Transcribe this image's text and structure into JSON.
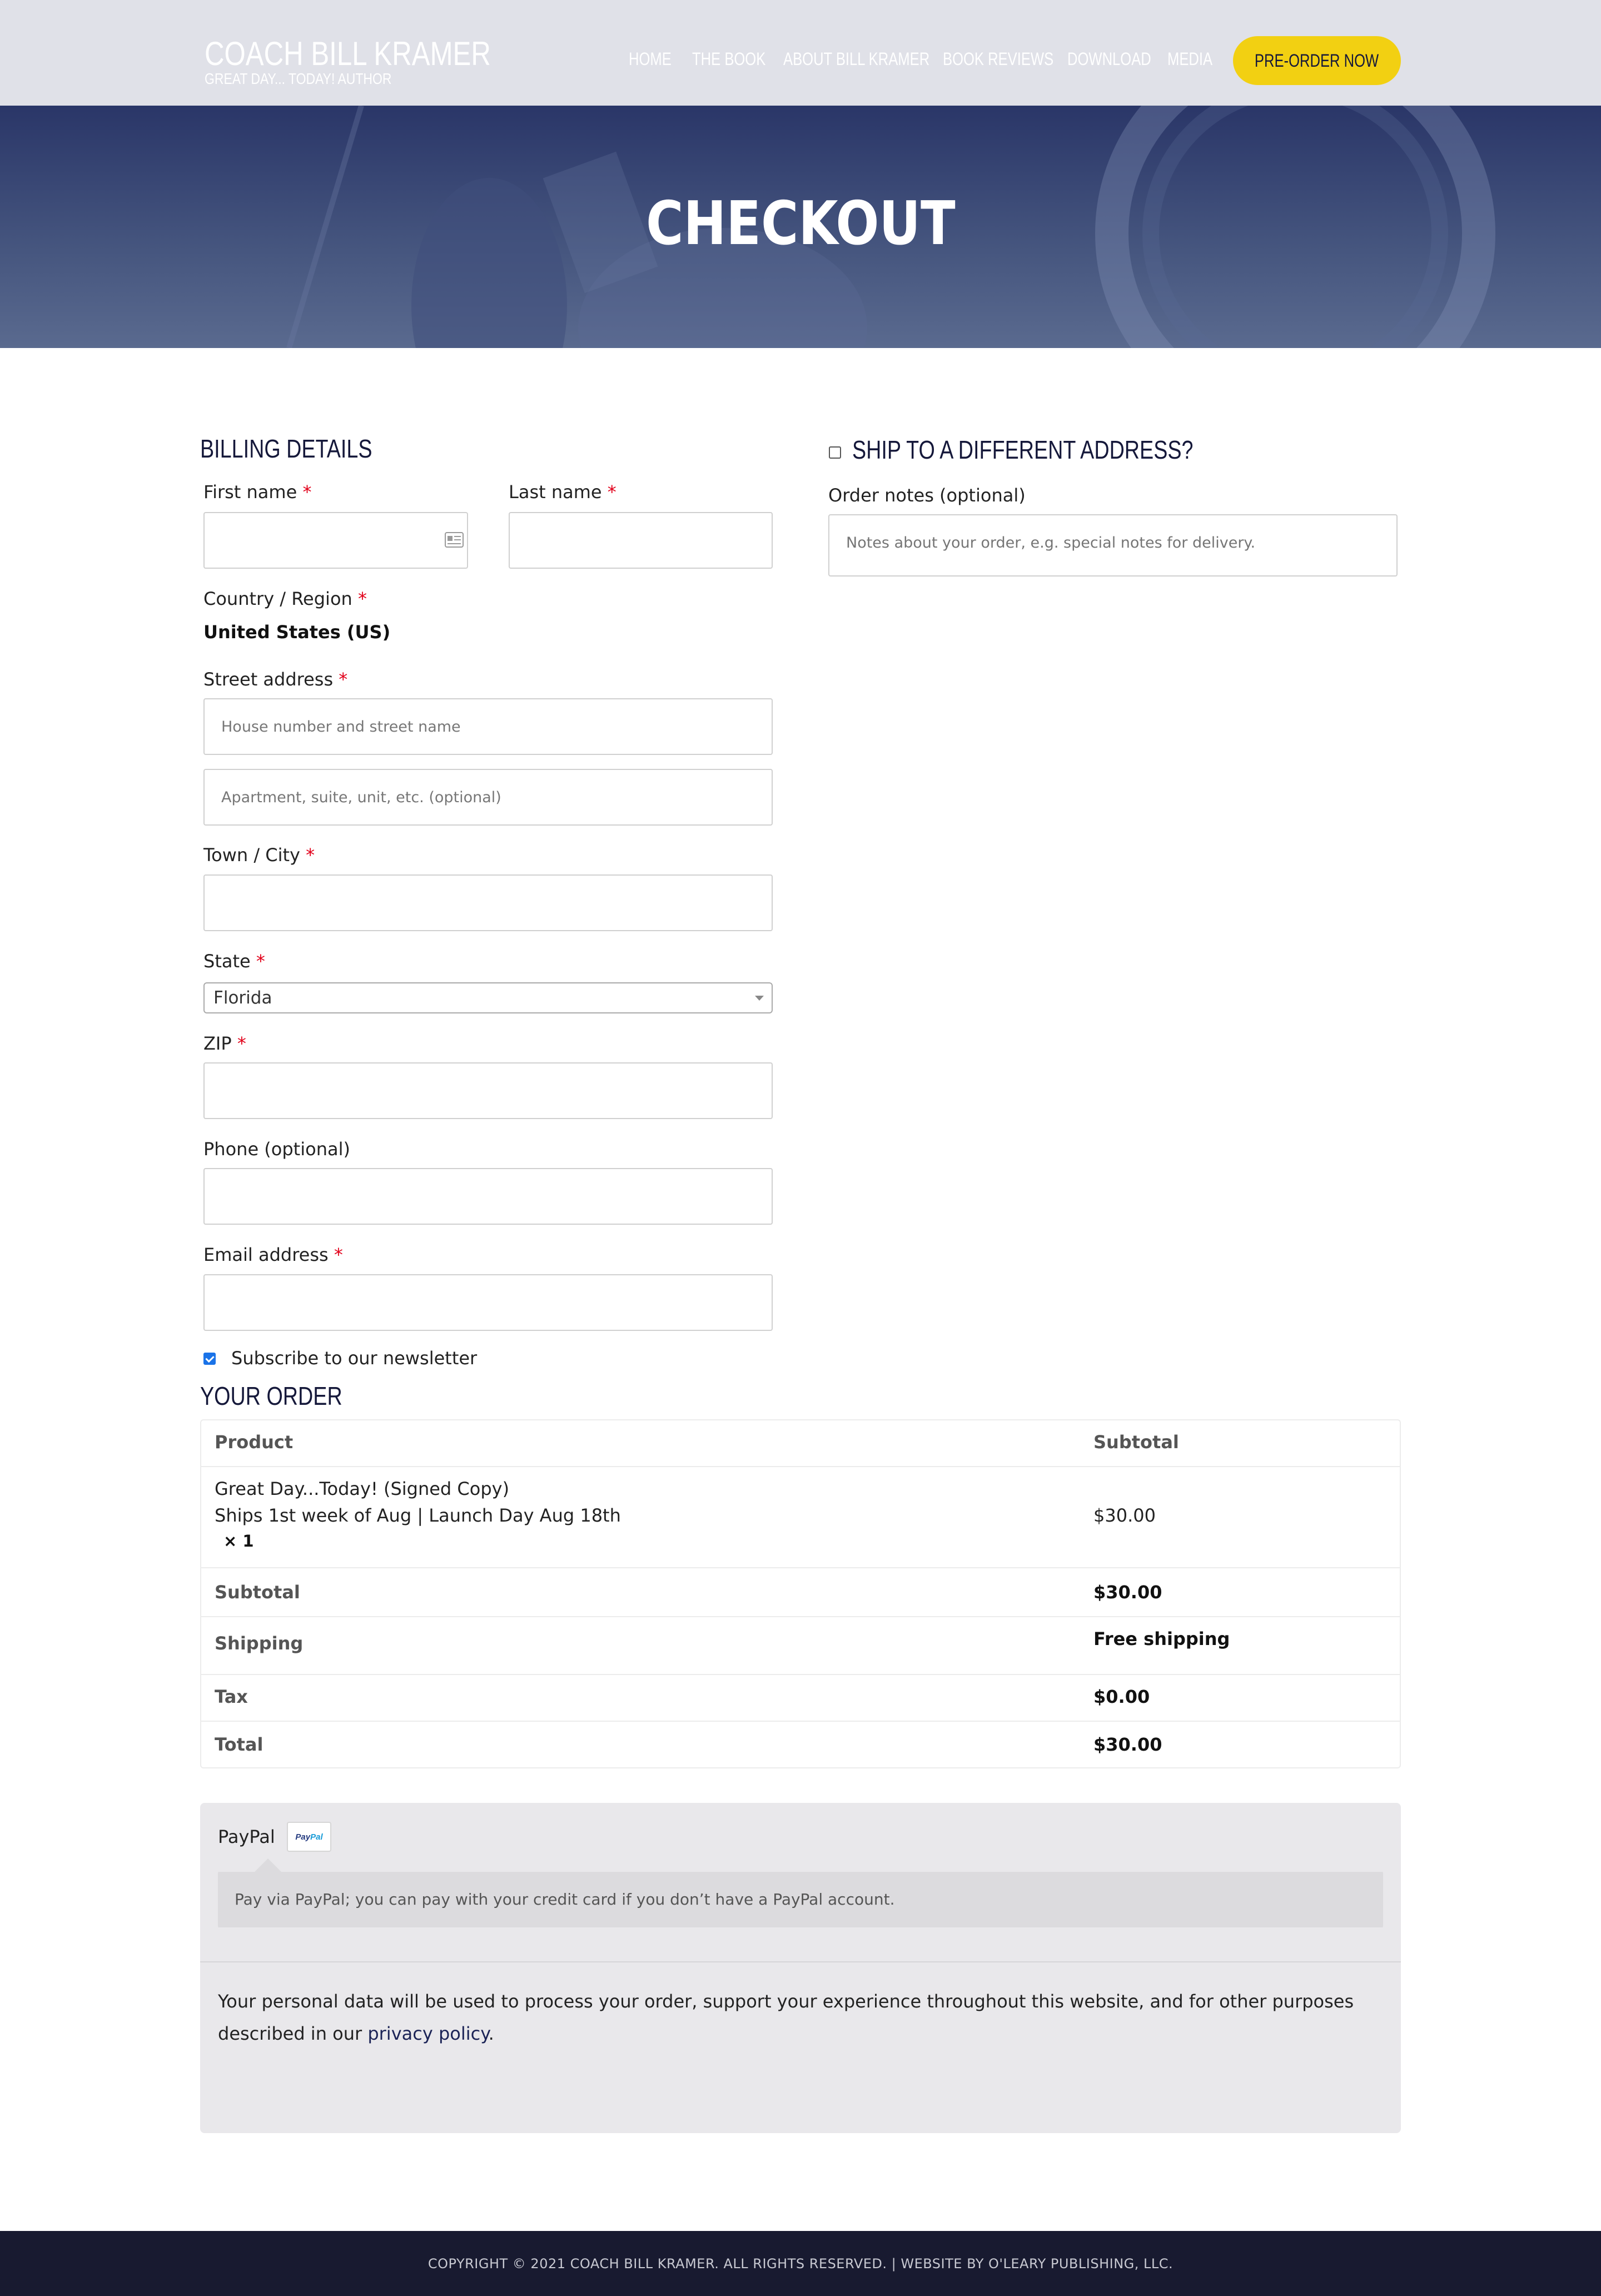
{
  "header": {
    "brand_title": "COACH BILL KRAMER",
    "brand_subtitle": "GREAT DAY... TODAY! AUTHOR",
    "nav": [
      "HOME",
      "THE BOOK",
      "ABOUT BILL KRAMER",
      "BOOK REVIEWS",
      "DOWNLOAD",
      "MEDIA"
    ],
    "cta_label": "PRE-ORDER NOW"
  },
  "hero": {
    "title": "CHECKOUT"
  },
  "billing": {
    "heading": "BILLING DETAILS",
    "first_name_label": "First name",
    "last_name_label": "Last name",
    "country_label": "Country / Region",
    "country_value": "United States (US)",
    "street_label": "Street address",
    "street_placeholder": "House number and street name",
    "apartment_placeholder": "Apartment, suite, unit, etc. (optional)",
    "city_label": "Town / City",
    "state_label": "State",
    "state_value": "Florida",
    "zip_label": "ZIP",
    "phone_label": "Phone (optional)",
    "email_label": "Email address",
    "newsletter_label": "Subscribe to our newsletter",
    "required_mark": "*"
  },
  "shipping": {
    "heading": "SHIP TO A DIFFERENT ADDRESS?",
    "notes_label": "Order notes (optional)",
    "notes_placeholder": "Notes about your order, e.g. special notes for delivery."
  },
  "order": {
    "heading": "YOUR ORDER",
    "col_product": "Product",
    "col_subtotal": "Subtotal",
    "item_name": "Great Day...Today! (Signed Copy)",
    "item_note": "Ships 1st week of Aug | Launch Day Aug 18th",
    "item_qty": "× 1",
    "item_price": "$30.00",
    "subtotal_label": "Subtotal",
    "subtotal_value": "$30.00",
    "shipping_label": "Shipping",
    "shipping_value": "Free shipping",
    "tax_label": "Tax",
    "tax_value": "$0.00",
    "total_label": "Total",
    "total_value": "$30.00"
  },
  "payment": {
    "method_label": "PayPal",
    "badge_part1": "Pay",
    "badge_part2": "Pal",
    "description": "Pay via PayPal; you can pay with your credit card if you don’t have a PayPal account.",
    "privacy_text": "Your personal data will be used to process your order, support your experience throughout this website, and for other purposes described in our ",
    "privacy_link": "privacy policy",
    "privacy_end": "."
  },
  "footer": {
    "text": "COPYRIGHT © 2021 COACH BILL KRAMER. ALL RIGHTS RESERVED. | WEBSITE BY O'LEARY PUBLISHING, LLC."
  },
  "colors": {
    "header_bg": "#e0e1e8",
    "cta_yellow": "#f2d012",
    "navy": "#15183a",
    "hero_blue": "#2a3668",
    "footer_bg": "#181a30",
    "required_red": "#e2001a"
  }
}
